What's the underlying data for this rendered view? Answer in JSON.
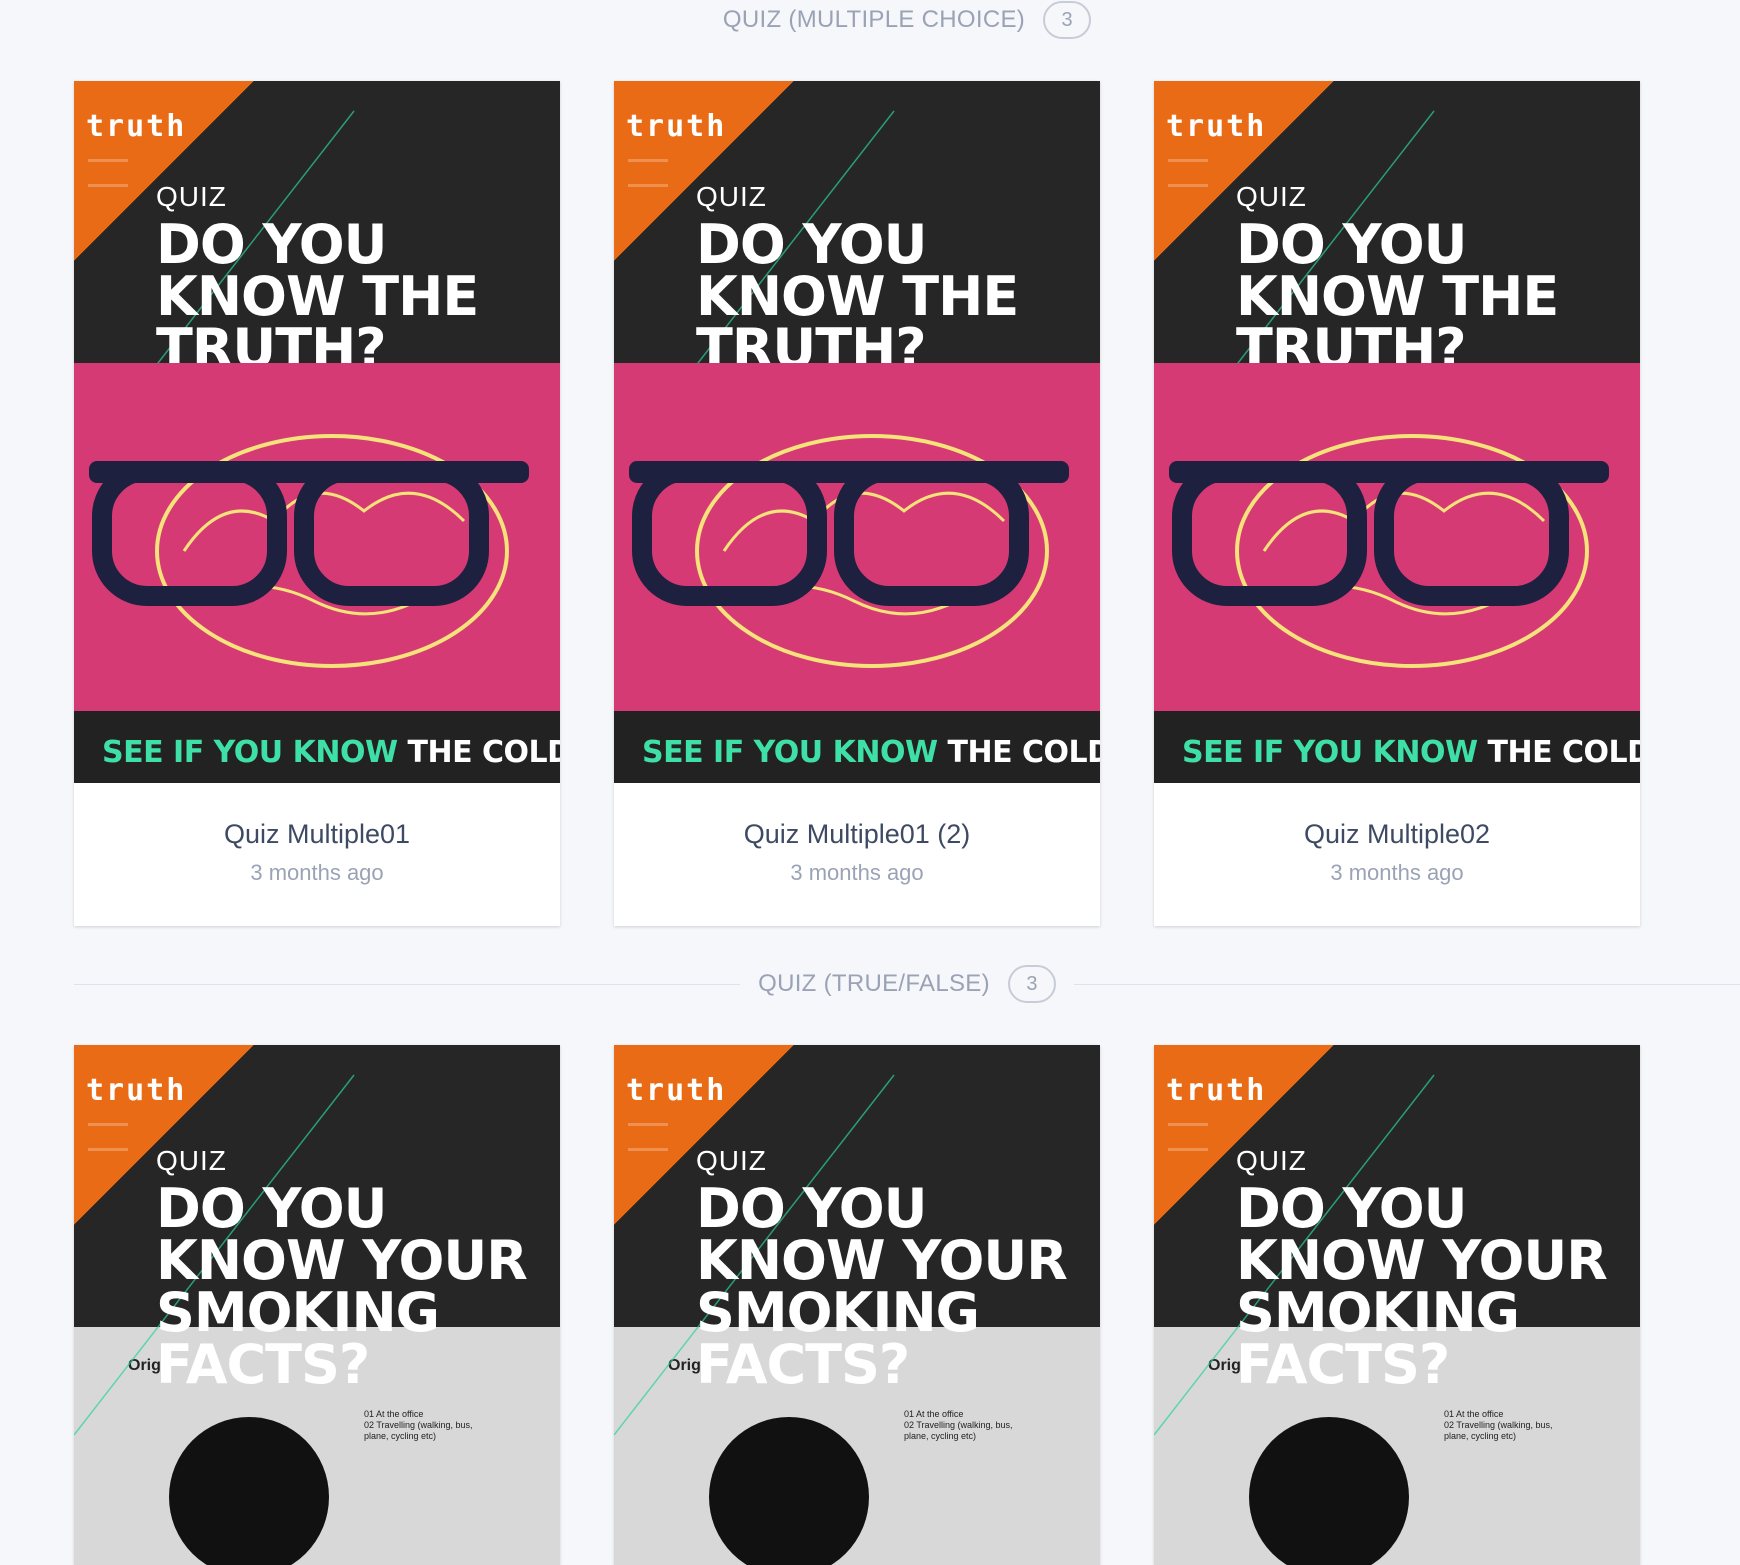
{
  "sections": [
    {
      "title": "QUIZ (MULTIPLE CHOICE)",
      "count": "3",
      "cards": [
        {
          "title": "Quiz Multiple01",
          "time": "3 months ago"
        },
        {
          "title": "Quiz Multiple01 (2)",
          "time": "3 months ago"
        },
        {
          "title": "Quiz Multiple02",
          "time": "3 months ago"
        }
      ],
      "thumb": {
        "logo": "truth",
        "kicker": "QUIZ",
        "headline": [
          "DO YOU",
          "KNOW THE",
          "TRUTH?"
        ],
        "tagline_green": "SEE IF YOU KNOW",
        "tagline_white": "THE COLD"
      }
    },
    {
      "title": "QUIZ (TRUE/FALSE)",
      "count": "3",
      "cards": [
        {},
        {},
        {}
      ],
      "thumb": {
        "logo": "truth",
        "kicker": "QUIZ",
        "headline": [
          "DO YOU",
          "KNOW YOUR",
          "SMOKING",
          "FACTS?"
        ],
        "chart_label": "Orig",
        "legend": [
          "01 At the office",
          "02 Travelling (walking, bus,",
          "plane, cycling etc)"
        ]
      }
    }
  ],
  "colors": {
    "background": "#f6f7fa",
    "accent_orange": "#ea6b16",
    "pink": "#d63a74",
    "green": "#3fe0a8"
  }
}
